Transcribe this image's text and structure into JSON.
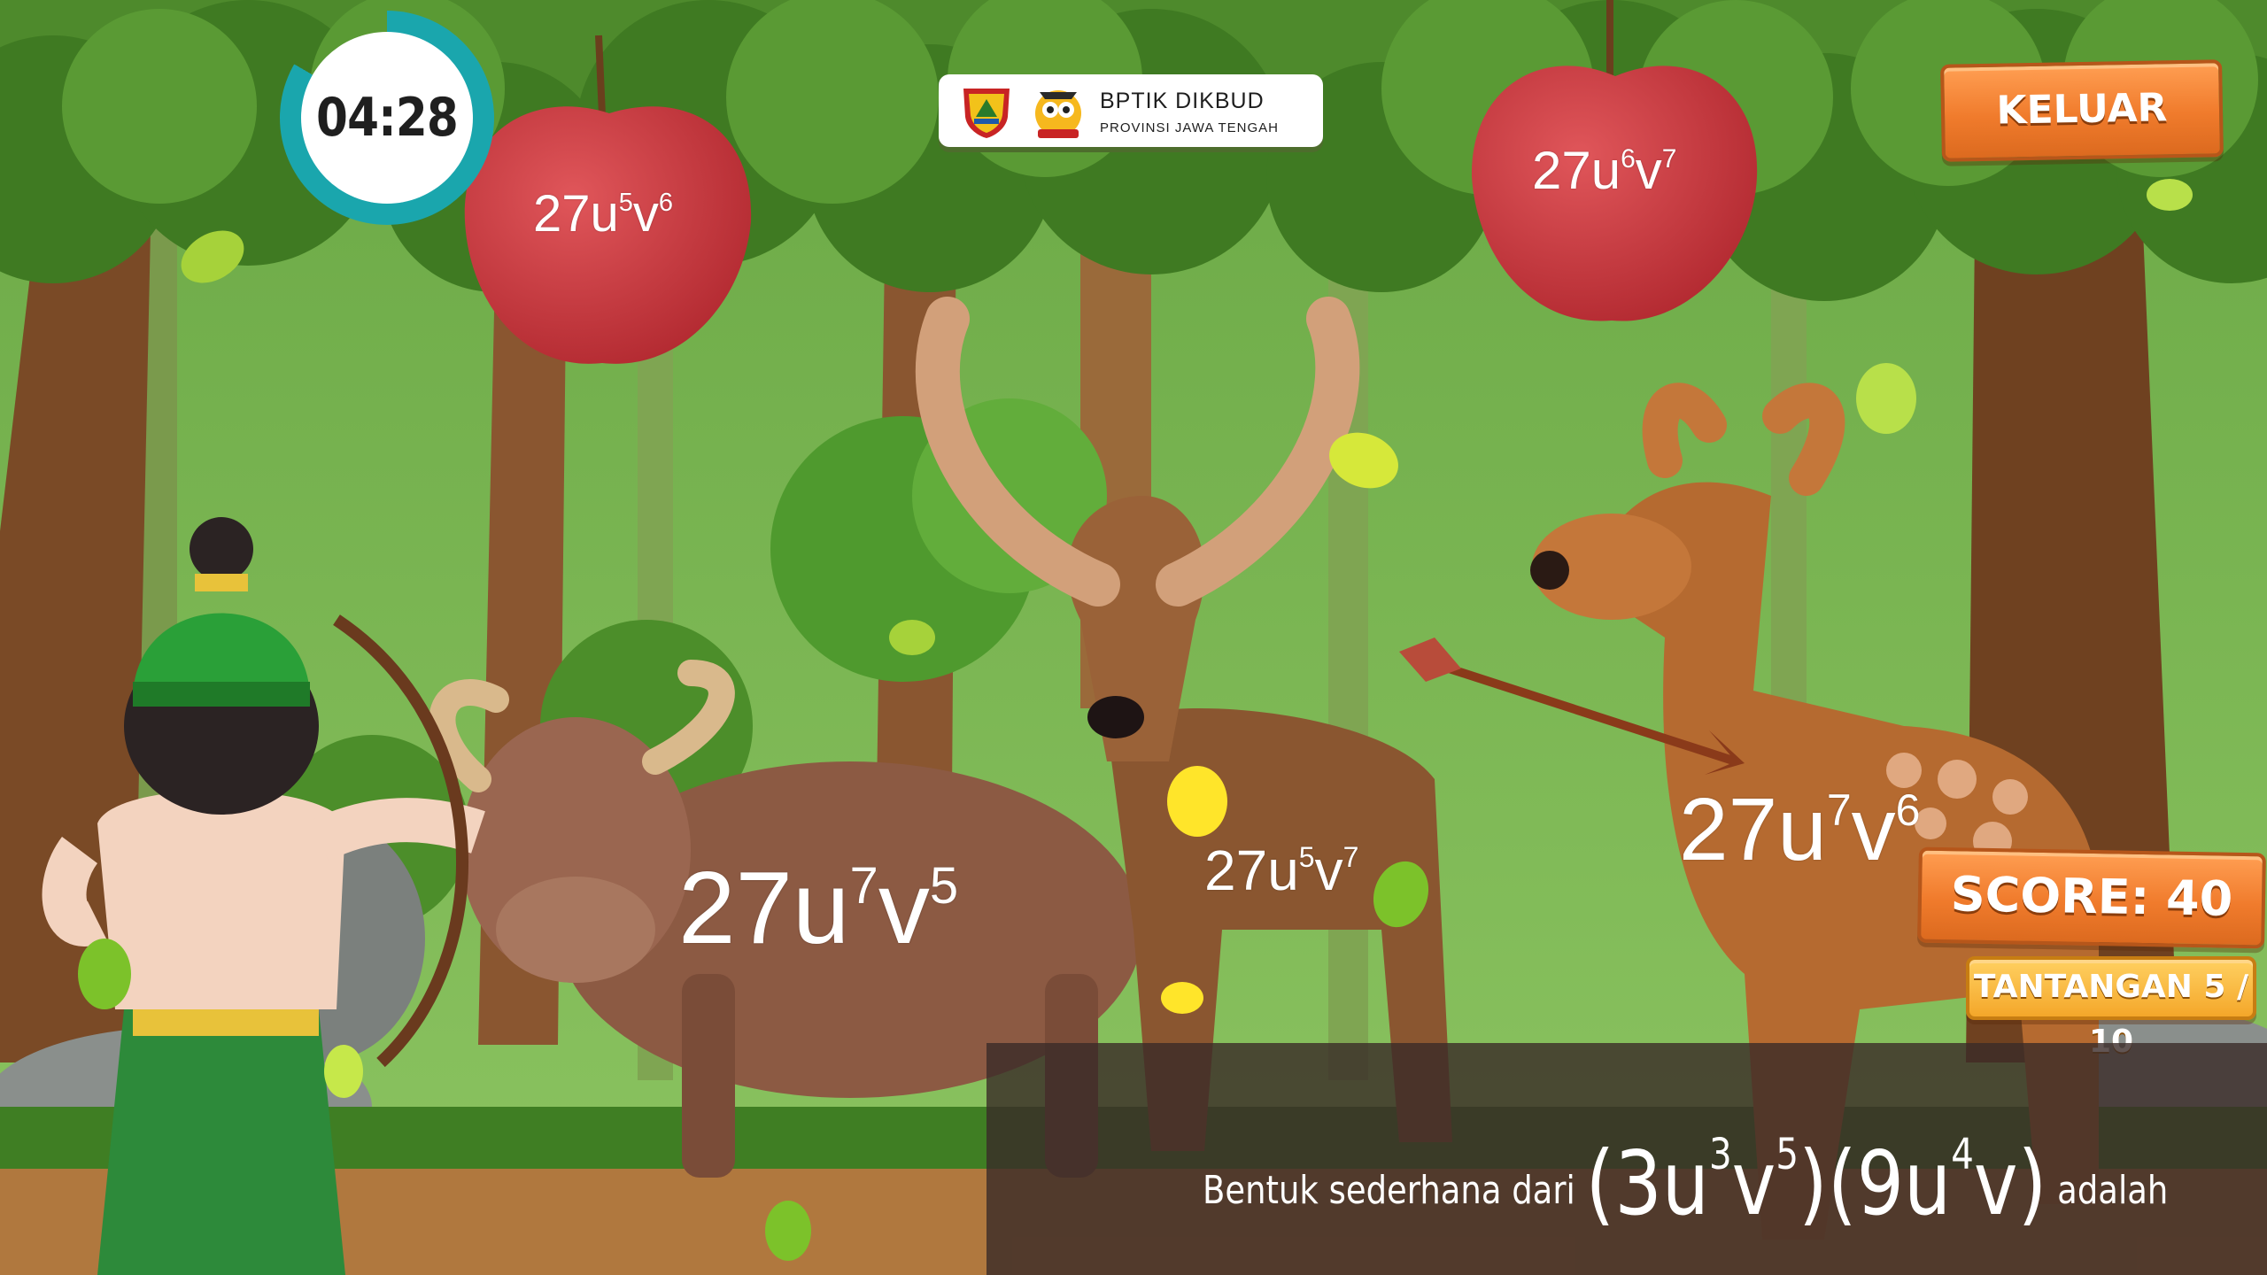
{
  "timer": {
    "time": "04:28"
  },
  "logo": {
    "title": "BPTIK DIKBUD",
    "subtitle": "PROVINSI JAWA TENGAH"
  },
  "exit_button": {
    "label": "KELUAR"
  },
  "score": {
    "label": "SCORE: 40"
  },
  "challenge": {
    "label": "TANTANGAN 5 / 10",
    "current": 5,
    "total": 10
  },
  "answers": {
    "apple_left": {
      "base": "27u",
      "exp1": "5",
      "var2": "v",
      "exp2": "6"
    },
    "apple_right": {
      "base": "27u",
      "exp1": "6",
      "var2": "v",
      "exp2": "7"
    },
    "buffalo": {
      "base": "27u",
      "exp1": "7",
      "var2": "v",
      "exp2": "5"
    },
    "elk": {
      "base": "27u",
      "exp1": "5",
      "var2": "v",
      "exp2": "7"
    },
    "deer": {
      "base": "27u",
      "exp1": "7",
      "var2": "v",
      "exp2": "6"
    }
  },
  "question": {
    "prefix": "Bentuk sederhana dari",
    "open1": "(3u",
    "e1": "3",
    "v1": "v",
    "e2": "5",
    "mid": ")(9u",
    "e3": "4",
    "tail": "v)",
    "suffix": "adalah"
  },
  "colors": {
    "timer_ring": "#1aa6ad",
    "wood_orange": "#f07b2c",
    "challenge_gold": "#f4a72a",
    "apple_red": "#c0353a",
    "question_overlay": "#3a2a28"
  }
}
